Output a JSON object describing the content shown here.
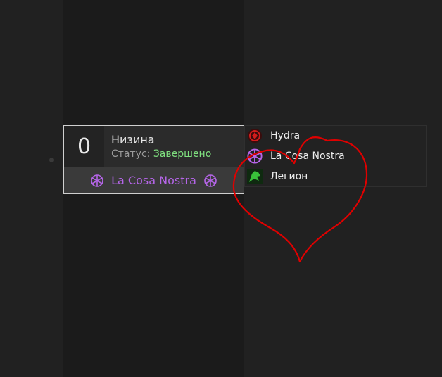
{
  "match": {
    "score": "0",
    "title": "Низина",
    "status_label": "Статус:",
    "status_value": "Завершено",
    "winner": "La Cosa Nostra"
  },
  "teams": [
    {
      "name": "Hydra",
      "icon": "hydra-logo-icon",
      "color": "#d11c1c"
    },
    {
      "name": "La Cosa Nostra",
      "icon": "cosa-nostra-logo-icon",
      "color": "#b565e8"
    },
    {
      "name": "Легион",
      "icon": "legion-logo-icon",
      "color": "#39c13a"
    }
  ],
  "colors": {
    "background": "#212121",
    "status_complete": "#7fe07f",
    "accent_purple": "#b565e8",
    "annotation_red": "#e00000"
  }
}
